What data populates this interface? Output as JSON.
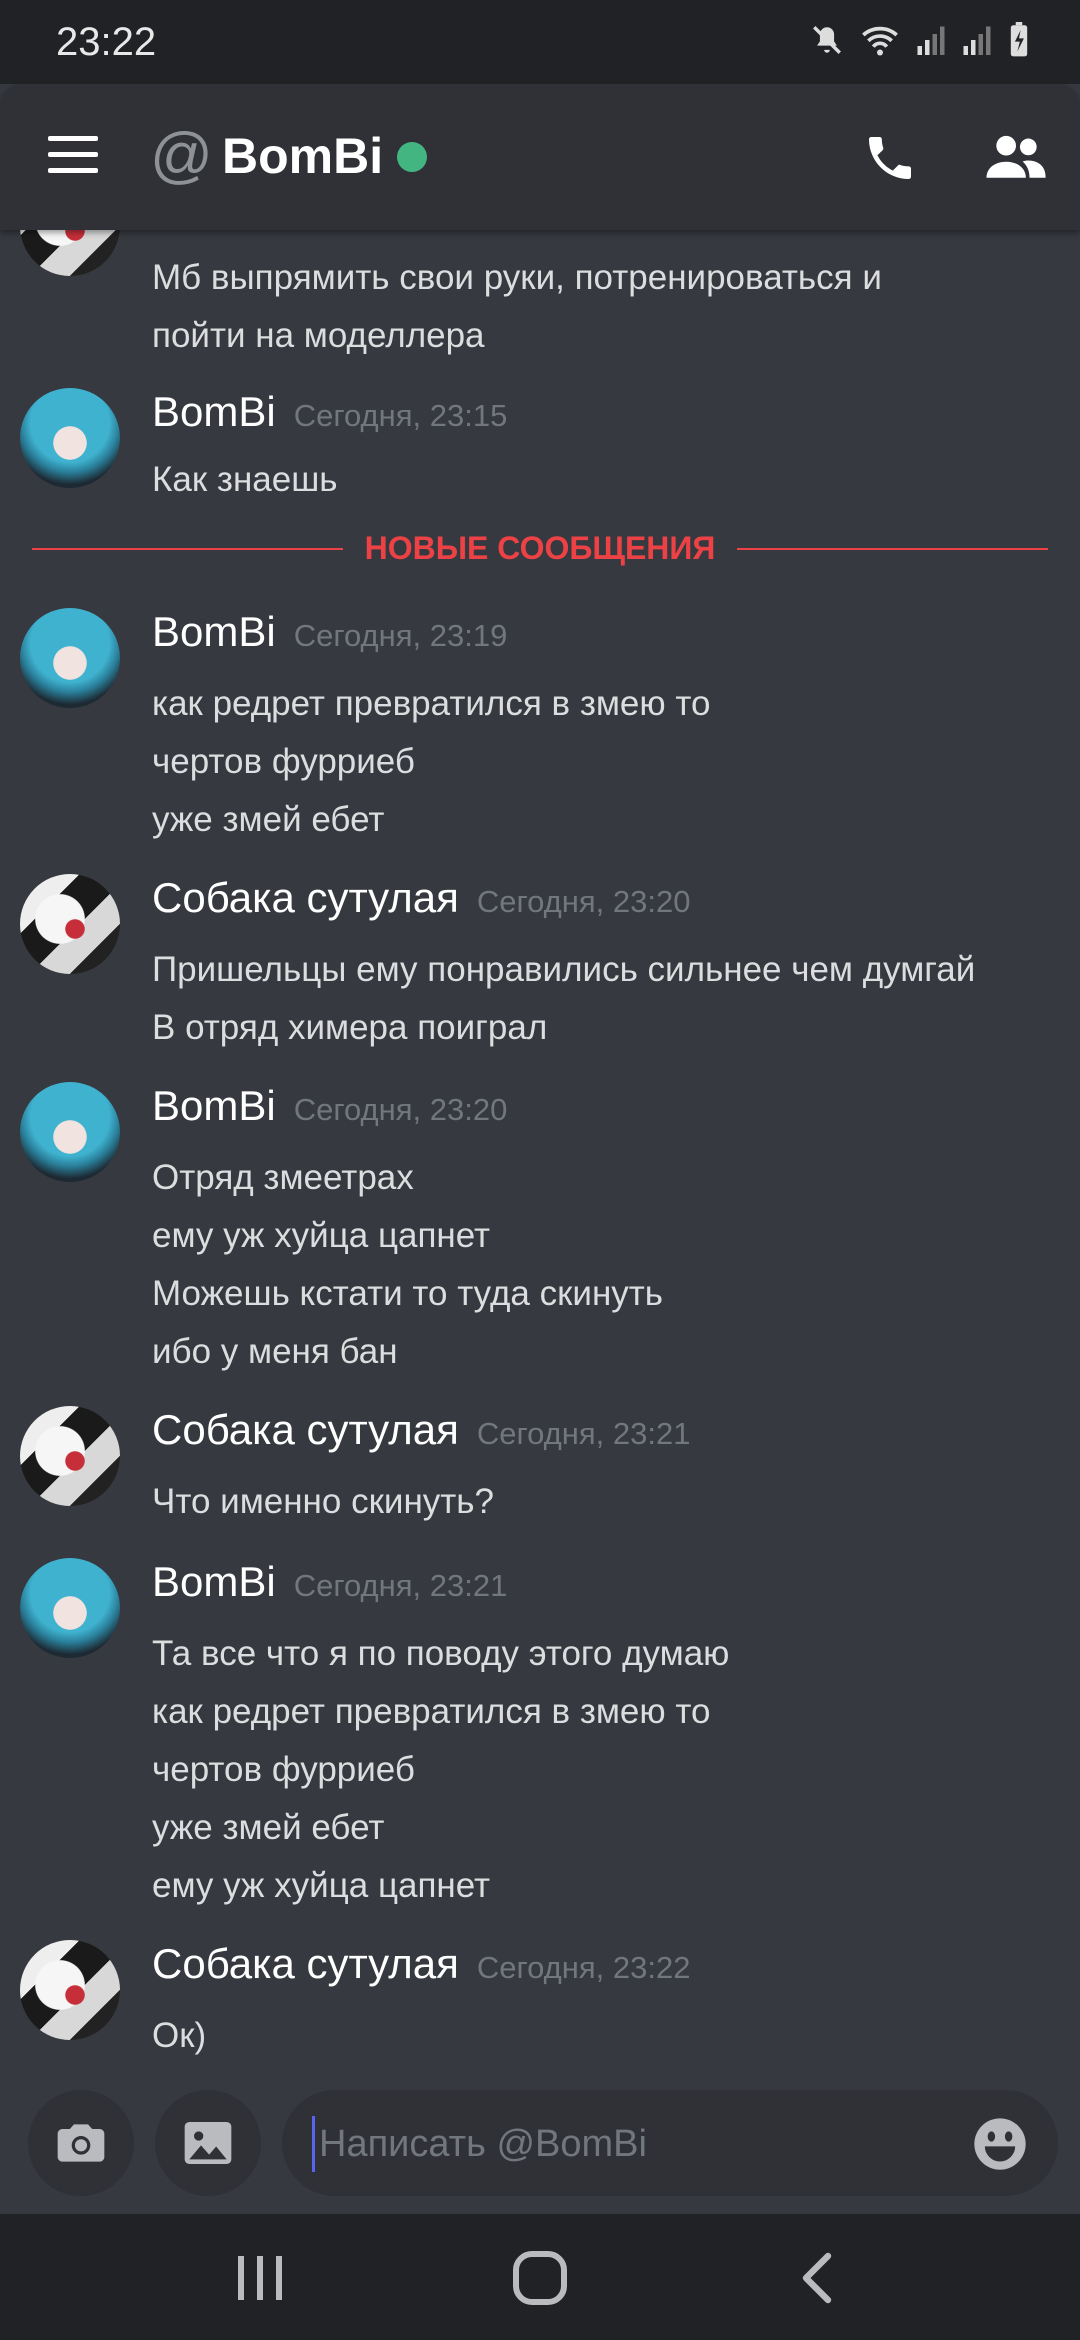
{
  "status_bar": {
    "time": "23:22"
  },
  "header": {
    "at_symbol": "@",
    "title": "BomBi",
    "icons": [
      "menu-icon",
      "at-icon",
      "online-status-dot",
      "phone-icon",
      "members-icon"
    ]
  },
  "divider": {
    "label": "НОВЫЕ СООБЩЕНИЯ"
  },
  "messages": [
    {
      "lines": [
        "Мб выпрямить свои руки, потренироваться и",
        "пойти на моделлера"
      ]
    },
    {
      "author": "BomBi",
      "time": "Сегодня, 23:15",
      "lines": [
        "Как знаешь"
      ]
    },
    {
      "author": "BomBi",
      "time": "Сегодня, 23:19",
      "lines": [
        "как редрет превратился в змею то",
        "чертов фурриеб",
        "уже змей ебет"
      ]
    },
    {
      "author": "Собака сутулая",
      "time": "Сегодня, 23:20",
      "lines": [
        "Пришельцы ему понравились сильнее чем думгай",
        "В отряд химера поиграл"
      ]
    },
    {
      "author": "BomBi",
      "time": "Сегодня, 23:20",
      "lines": [
        "Отряд змеетрах",
        "ему уж хуйца цапнет",
        "Можешь кстати то туда скинуть",
        "ибо у меня бан"
      ]
    },
    {
      "author": "Собака сутулая",
      "time": "Сегодня, 23:21",
      "lines": [
        "Что именно скинуть?"
      ]
    },
    {
      "author": "BomBi",
      "time": "Сегодня, 23:21",
      "lines": [
        "Та все что я по поводу этого думаю",
        "как редрет превратился в змею то",
        "чертов фурриеб",
        "уже змей ебет",
        "ему уж хуйца цапнет"
      ]
    },
    {
      "author": "Собака сутулая",
      "time": "Сегодня, 23:22",
      "lines": [
        "Ок)"
      ]
    }
  ],
  "composer": {
    "placeholder": "Написать @BomBi",
    "value": ""
  },
  "colors": {
    "background": "#36393f",
    "header": "#2f3136",
    "accent_red": "#ed4245",
    "online": "#43b581",
    "bars": "#202225"
  }
}
